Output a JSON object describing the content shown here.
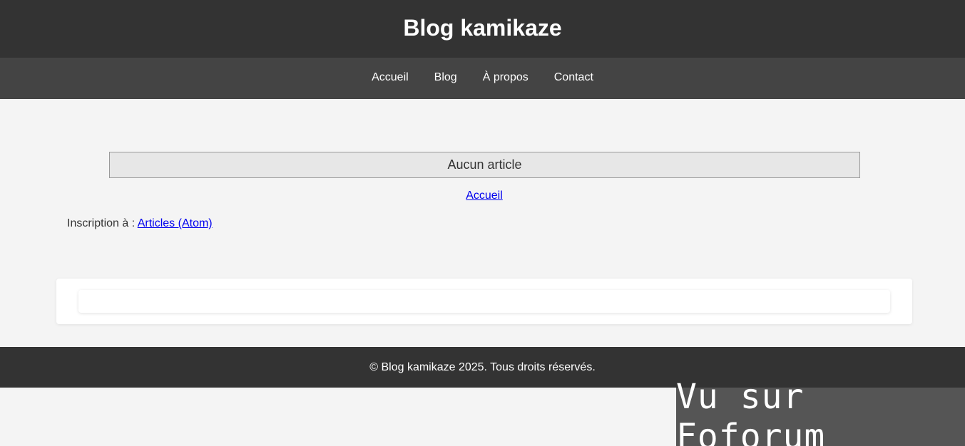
{
  "header": {
    "title": "Blog kamikaze"
  },
  "nav": {
    "items": [
      {
        "label": "Accueil"
      },
      {
        "label": "Blog"
      },
      {
        "label": "À propos"
      },
      {
        "label": "Contact"
      }
    ]
  },
  "main": {
    "empty_message": "Aucun article",
    "home_link": "Accueil",
    "feed_prefix": "Inscription à : ",
    "feed_link": "Articles (Atom)"
  },
  "footer": {
    "text": "© Blog kamikaze 2025. Tous droits réservés."
  },
  "badge": {
    "text": "Vu sur Foforum"
  },
  "colors": {
    "header_bg": "#333333",
    "nav_bg": "#444444",
    "page_bg": "#f4f4f4",
    "link": "#0000ee",
    "badge_bg": "#555555"
  }
}
